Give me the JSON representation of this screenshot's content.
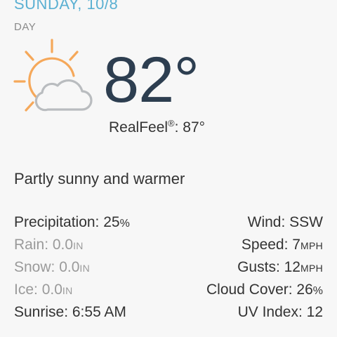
{
  "header": {
    "date": "SUNDAY, 10/8",
    "period": "DAY"
  },
  "current": {
    "icon": "partly-sunny-icon",
    "temperature": "82°",
    "realfeel_label": "RealFeel",
    "realfeel_mark": "®",
    "realfeel_value": ": 87°",
    "phrase": "Partly sunny and warmer"
  },
  "details": {
    "precipitation": {
      "label": "Precipitation: ",
      "value": "25",
      "unit": "%"
    },
    "rain": {
      "label": "Rain: ",
      "value": "0.0",
      "unit": "IN"
    },
    "snow": {
      "label": "Snow: ",
      "value": "0.0",
      "unit": "IN"
    },
    "ice": {
      "label": "Ice: ",
      "value": "0.0",
      "unit": "IN"
    },
    "sunrise": {
      "label": "Sunrise: ",
      "value": "6:55 AM"
    },
    "wind": {
      "label": "Wind: ",
      "value": "SSW"
    },
    "speed": {
      "label": "Speed: ",
      "value": "7",
      "unit": "MPH"
    },
    "gusts": {
      "label": "Gusts: ",
      "value": "12",
      "unit": "MPH"
    },
    "cloud_cover": {
      "label": "Cloud Cover: ",
      "value": "26",
      "unit": "%"
    },
    "uv_index": {
      "label": "UV Index: ",
      "value": "12"
    }
  },
  "colors": {
    "date_accent": "#5bb0d2",
    "sun": "#f5a85a",
    "cloud": "#b9bcbf",
    "temperature": "#2d3e50",
    "muted_text": "#9a9a9a"
  }
}
